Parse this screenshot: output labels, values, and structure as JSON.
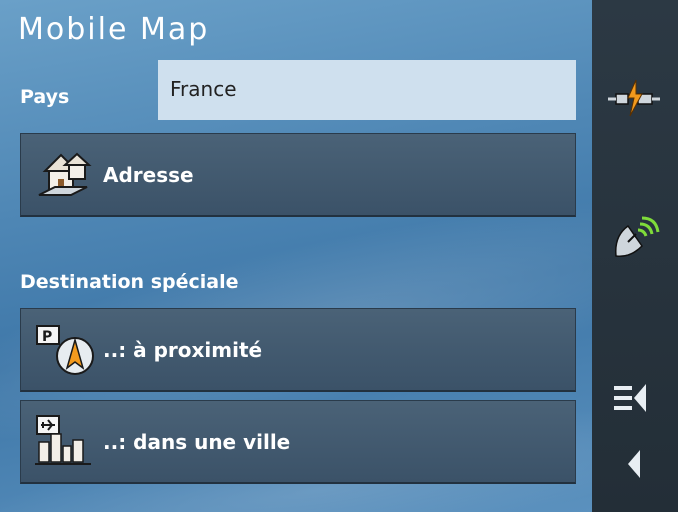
{
  "app": {
    "title": "Mobile Map"
  },
  "country": {
    "label": "Pays",
    "value": "France"
  },
  "buttons": {
    "address": {
      "label": "Adresse",
      "icon": "house-icon"
    },
    "nearby": {
      "label": "..: à proximité",
      "icon": "poi-compass-icon"
    },
    "in_city": {
      "label": "..: dans une ville",
      "icon": "city-airport-icon"
    }
  },
  "special_destination": {
    "label": "Destination spéciale"
  },
  "sidebar": {
    "items": [
      {
        "name": "power-plug-icon"
      },
      {
        "name": "satellite-gps-icon"
      },
      {
        "name": "menu-back-icon"
      },
      {
        "name": "back-arrow-icon"
      }
    ]
  },
  "colors": {
    "panel": "#4f87b5",
    "sidebar": "#2a3641",
    "field": "#cfe0ee",
    "button": "#435b70",
    "accent_orange": "#f39a1d",
    "accent_green": "#7fdc3a"
  }
}
